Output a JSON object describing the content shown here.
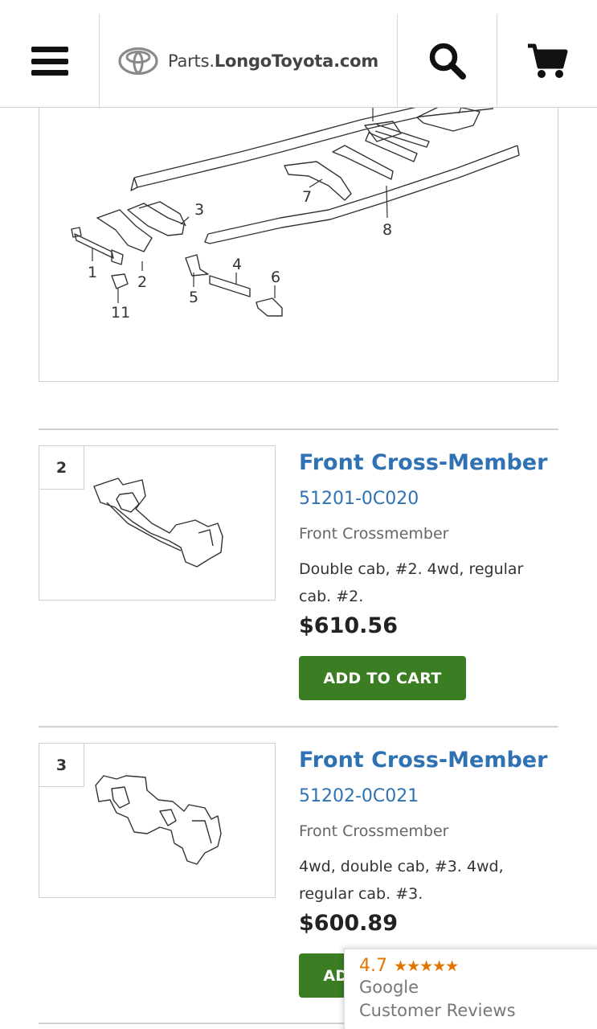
{
  "header": {
    "menu_icon": "hamburger-icon",
    "logo_icon": "toyota-logo-icon",
    "site_name_plain": "Parts.",
    "site_name_bold": "LongoToyota.com",
    "search_icon": "search-icon",
    "cart_icon": "cart-icon"
  },
  "diagram": {
    "callouts": [
      "3",
      "7",
      "8",
      "1",
      "2",
      "4",
      "6",
      "5",
      "11"
    ]
  },
  "parts": [
    {
      "ref": "2",
      "title": "Front Cross-Member",
      "part_number": "51201-0C020",
      "description": "Front Crossmember",
      "notes": "Double cab, #2. 4wd, regular cab. #2.",
      "price": "$610.56",
      "button": "ADD TO CART"
    },
    {
      "ref": "3",
      "title": "Front Cross-Member",
      "part_number": "51202-0C021",
      "description": "Front Crossmember",
      "notes": "4wd, double cab, #3. 4wd, regular cab. #3.",
      "price": "$600.89",
      "button": "ADD TO CART"
    }
  ],
  "google_badge": {
    "rating": "4.7",
    "stars": "★★★★★",
    "line1": "Google",
    "line2": "Customer Reviews"
  },
  "colors": {
    "link_blue": "#2f72b4",
    "button_green": "#3b7d23",
    "star_orange": "#e37400"
  }
}
